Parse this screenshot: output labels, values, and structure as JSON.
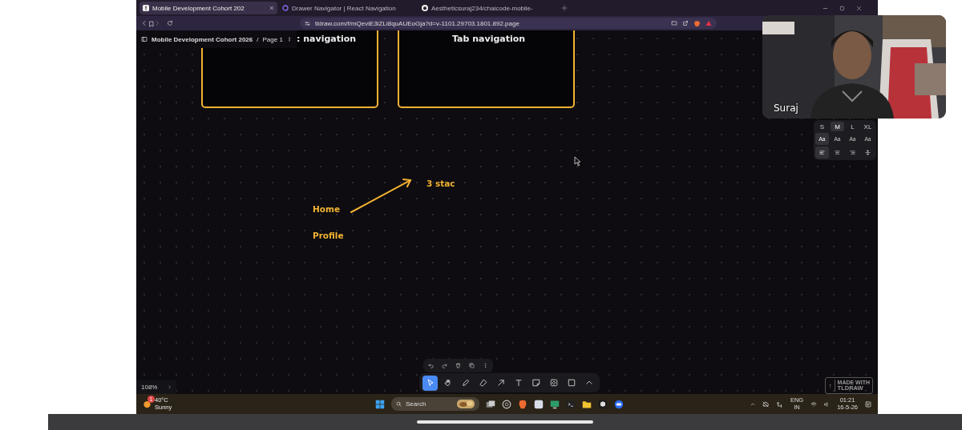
{
  "browser": {
    "tabs": [
      {
        "title": "Mobile Development Cohort 202",
        "selected": true,
        "kind": "tldraw"
      },
      {
        "title": "Drawer Navigator | React Navigation",
        "selected": false,
        "kind": "ring"
      },
      {
        "title": "Aestheticsuraj234/chaicode-mobile-",
        "selected": false,
        "kind": "github"
      }
    ],
    "url": "tldraw.com/f/mQeviE3lZLi8quAUEoGja?d=v-1101.29703.1801.892.page"
  },
  "tldraw": {
    "document": "Mobile Development Cohort 2026",
    "separator": "/",
    "page": "Page 1",
    "frames": [
      {
        "title": ": navigation"
      },
      {
        "title": "Tab navigation"
      }
    ],
    "labels": [
      {
        "text": "3 stac"
      },
      {
        "text": "Home"
      },
      {
        "text": "Profile"
      }
    ],
    "style_panel": {
      "sizes": [
        {
          "label": "S",
          "selected": false
        },
        {
          "label": "M",
          "selected": true
        },
        {
          "label": "L",
          "selected": false
        },
        {
          "label": "XL",
          "selected": false
        }
      ],
      "fonts": [
        {
          "label": "Aa",
          "selected": true
        },
        {
          "label": "Aa",
          "selected": false
        },
        {
          "label": "Aa",
          "selected": false
        },
        {
          "label": "Aa",
          "selected": false
        }
      ],
      "aligns": [
        {
          "kind": "left",
          "selected": true
        },
        {
          "kind": "center",
          "selected": false
        },
        {
          "kind": "right",
          "selected": false
        },
        {
          "kind": "middle",
          "selected": false
        }
      ]
    },
    "actions": [
      {
        "kind": "undo"
      },
      {
        "kind": "redo"
      },
      {
        "kind": "delete"
      },
      {
        "kind": "duplicate"
      },
      {
        "kind": "more"
      }
    ],
    "tools": [
      {
        "kind": "select",
        "selected": true
      },
      {
        "kind": "hand",
        "selected": false
      },
      {
        "kind": "draw",
        "selected": false
      },
      {
        "kind": "eraser",
        "selected": false
      },
      {
        "kind": "arrow",
        "selected": false
      },
      {
        "kind": "text",
        "selected": false
      },
      {
        "kind": "note",
        "selected": false
      },
      {
        "kind": "media",
        "selected": false
      },
      {
        "kind": "rectangle",
        "selected": false
      },
      {
        "kind": "expand",
        "selected": false
      }
    ],
    "zoom": "108%",
    "badge": [
      "MADE WITH",
      "TLDRAW"
    ]
  },
  "taskbar": {
    "weather": {
      "badge": "1",
      "temp": "40°C",
      "condition": "Sunny"
    },
    "search": {
      "placeholder": "Search"
    },
    "language": [
      "ENG",
      "IN"
    ],
    "time": "01:21",
    "date": "16-5-26"
  },
  "webcam": {
    "name": "Suraj"
  }
}
